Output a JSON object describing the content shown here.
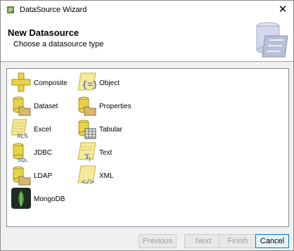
{
  "window": {
    "title": "DataSource Wizard",
    "close_glyph": "✕"
  },
  "header": {
    "title": "New Datasource",
    "subtitle": "Choose a datasource type"
  },
  "datasource_types": [
    {
      "label": "Composite",
      "icon": "composite-plus-icon"
    },
    {
      "label": "Dataset",
      "icon": "database-folder-icon"
    },
    {
      "label": "Excel",
      "icon": "xls-file-icon"
    },
    {
      "label": "JDBC",
      "icon": "database-sql-icon"
    },
    {
      "label": "LDAP",
      "icon": "database-folder-icon"
    },
    {
      "label": "MongoDB",
      "icon": "mongodb-leaf-icon"
    },
    {
      "label": "Object",
      "icon": "object-braces-icon"
    },
    {
      "label": "Properties",
      "icon": "database-folder-icon"
    },
    {
      "label": "Tabular",
      "icon": "database-table-icon"
    },
    {
      "label": "Text",
      "icon": "text-document-icon"
    },
    {
      "label": "XML",
      "icon": "xml-tag-icon"
    }
  ],
  "buttons": {
    "previous": "Previous",
    "next": "Next",
    "finish": "Finish",
    "cancel": "Cancel"
  },
  "colors": {
    "db_yellow": "#e8d24a",
    "folder": "#d9b86b",
    "accent_blue": "#0078d7",
    "mongo_green": "#4a9a3c"
  }
}
